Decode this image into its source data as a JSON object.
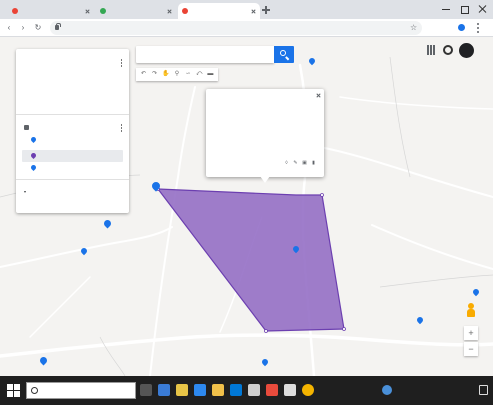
{
  "browser": {
    "tabs": [
      {
        "title": "",
        "favicon_color": "#ea4335"
      },
      {
        "title": "",
        "favicon_color": "#34a853"
      },
      {
        "title": "",
        "favicon_color": "#ea4335"
      }
    ],
    "url": "",
    "icons": [
      "back-icon",
      "forward-icon",
      "reload-icon",
      "lock-icon",
      "star-icon",
      "menu-icon"
    ]
  },
  "map": {
    "search": {
      "placeholder": ""
    },
    "polygon": {
      "fill": "#8e66c2",
      "stroke": "#6c3fb0"
    },
    "labels": [
      "",
      "",
      "",
      "",
      "",
      "",
      "",
      "",
      "",
      "",
      "",
      "",
      "",
      "",
      "",
      "",
      "",
      "",
      "",
      ""
    ],
    "logo_text": ""
  },
  "panel": {
    "title": "",
    "subtitle": "",
    "description": "",
    "actions": [
      "",
      "",
      ""
    ],
    "layer": {
      "name": "",
      "style_link": "",
      "items": [
        "",
        ""
      ]
    },
    "basemap": ""
  },
  "popup": {
    "title": "",
    "description_lines": [
      "",
      "",
      ""
    ],
    "meta": ""
  },
  "taskbar": {
    "search_text": "",
    "tray_lines": [
      "",
      ""
    ]
  },
  "colors": {
    "accent": "#1a73e8",
    "polygon_fill": "#8e66c2",
    "marker": "#1a73e8",
    "layer_pin": "#6c3fb0"
  }
}
